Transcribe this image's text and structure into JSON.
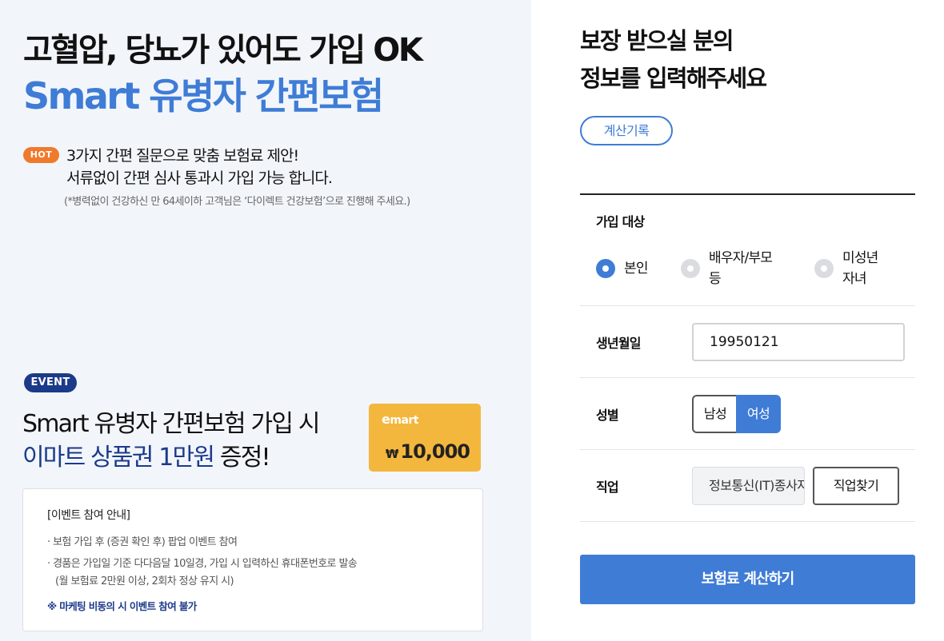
{
  "hero": {
    "title_line1": "고혈압, 당뇨가 있어도 가입 OK",
    "title_line2": "Smart 유병자 간편보험"
  },
  "hot": {
    "badge": "HOT",
    "line1": "3가지 간편 질문으로 맞춤 보험료 제안!",
    "line2": "서류없이 간편 심사 통과시 가입 가능 합니다.",
    "note": "(*병력없이 건강하신 만 64세이하 고객님은 ‘다이렉트 건강보험’으로 진행해 주세요.)"
  },
  "event": {
    "badge": "EVENT",
    "title_line1": "Smart 유병자 간편보험 가입 시",
    "title_line2_highlight": "이마트 상품권 1만원",
    "title_line2_rest": " 증정!",
    "giftcard": {
      "brand_e": "e",
      "brand_rest": "mart",
      "currency": "₩",
      "amount": "10,000"
    },
    "info": {
      "title": "[이벤트 참여 안내]",
      "line1": "· 보험 가입 후 (증권 확인 후) 팝업 이벤트 참여",
      "line2": "· 경품은 가입일 기준 다다음달 10일경, 가입 시 입력하신 휴대폰번호로 발송",
      "line3": "(월 보험료 2만원 이상, 2회차 정상 유지 시)",
      "warning": "※ 마케팅 비동의 시 이벤트 참여 불가"
    }
  },
  "form": {
    "title_line1": "보장 받으실 분의",
    "title_line2": "정보를 입력해주세요",
    "history_button": "계산기록",
    "target": {
      "label": "가입 대상",
      "options": [
        {
          "label": "본인",
          "selected": true
        },
        {
          "label_line1": "배우자/부모",
          "label_line2": "등",
          "selected": false
        },
        {
          "label_line1": "미성년",
          "label_line2": "자녀",
          "selected": false
        }
      ]
    },
    "birth": {
      "label": "생년월일",
      "value": "19950121"
    },
    "gender": {
      "label": "성별",
      "male": "남성",
      "female": "여성",
      "selected": "여성"
    },
    "job": {
      "label": "직업",
      "value": "정보통신(IT)종사자",
      "search_button": "직업찾기"
    },
    "submit_button": "보험료 계산하기"
  },
  "colors": {
    "accent_blue": "#3f7cd6",
    "navy": "#1c3a8a",
    "hot_orange": "#f07a2c",
    "giftcard_yellow": "#f4b73d",
    "left_panel_bg": "#f2f6fb"
  }
}
